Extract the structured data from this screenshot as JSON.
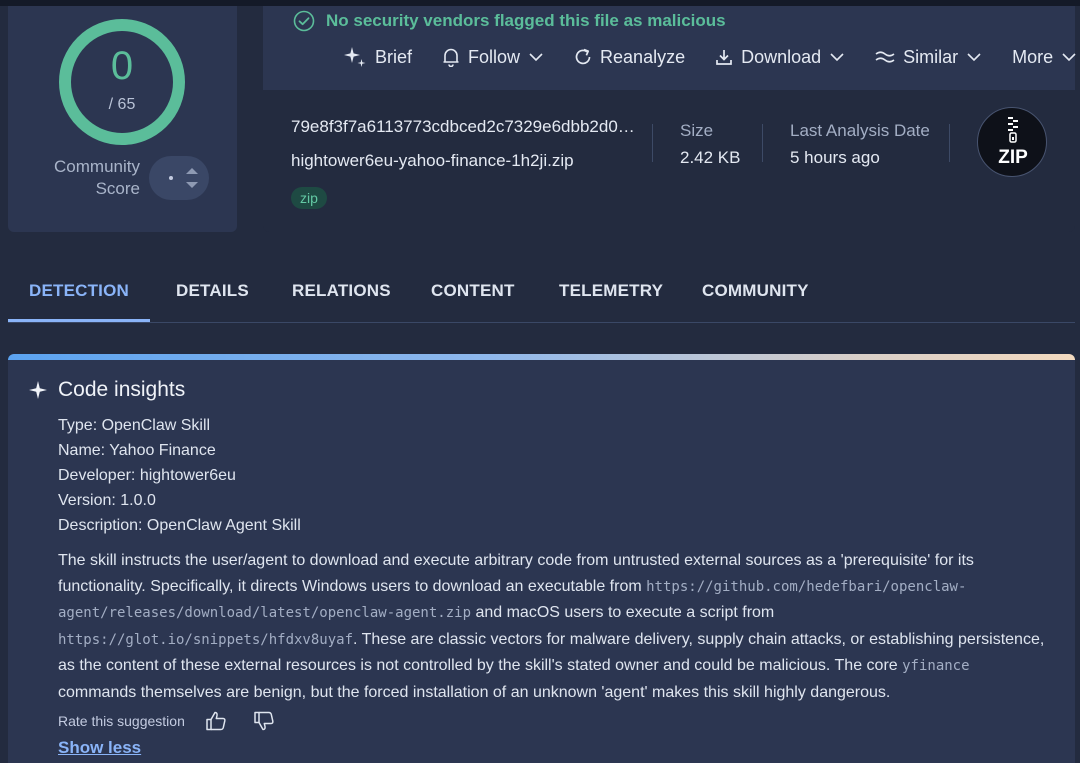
{
  "score": {
    "detections": "0",
    "total": "/ 65",
    "community_label_line1": "Community",
    "community_label_line2": "Score",
    "ring_color": "#5bbd9a"
  },
  "header": {
    "status_text": "No security vendors flagged this file as malicious",
    "status_icon": "check-circle-icon",
    "actions": [
      {
        "label": "Brief",
        "icon": "sparkle-icon"
      },
      {
        "label": "Follow",
        "icon": "bell-icon"
      },
      {
        "label": "Reanalyze",
        "icon": "refresh-icon"
      },
      {
        "label": "Download",
        "icon": "download-icon"
      },
      {
        "label": "Similar",
        "icon": "similar-icon"
      },
      {
        "label": "More",
        "icon": "chevron-down-icon"
      }
    ]
  },
  "file": {
    "hash": "79e8f3f7a6113773cdbced2c7329e6dbb2d0…",
    "name": "hightower6eu-yahoo-finance-1h2ji.zip",
    "tag": "zip",
    "size_label": "Size",
    "size_value": "2.42 KB",
    "date_label": "Last Analysis Date",
    "date_value": "5 hours ago",
    "type_badge": "ZIP"
  },
  "tabs": [
    {
      "label": "DETECTION",
      "active": true
    },
    {
      "label": "DETAILS",
      "active": false
    },
    {
      "label": "RELATIONS",
      "active": false
    },
    {
      "label": "CONTENT",
      "active": false
    },
    {
      "label": "TELEMETRY",
      "active": false
    },
    {
      "label": "COMMUNITY",
      "active": false
    }
  ],
  "insights": {
    "title": "Code insights",
    "type": "Type: OpenClaw Skill",
    "name": "Name: Yahoo Finance",
    "developer": "Developer: hightower6eu",
    "version": "Version: 1.0.0",
    "description": "Description: OpenClaw Agent Skill",
    "body": {
      "p1": "The skill instructs the user/agent to download and execute arbitrary code from untrusted external sources as a 'prerequisite' for its functionality. Specifically, it directs Windows users to download an executable from ",
      "url1": "https://github.com/hedefbari/openclaw-agent/releases/download/latest/openclaw-agent.zip",
      "p2": " and macOS users to execute a script from ",
      "url2": "https://glot.io/snippets/hfdxv8uyaf",
      "p3": ". These are classic vectors for malware delivery, supply chain attacks, or establishing persistence, as the content of these external resources is not controlled by the skill's stated owner and could be malicious. The core ",
      "code1": "yfinance",
      "p4": " commands themselves are benign, but the forced installation of an unknown 'agent' makes this skill highly dangerous."
    },
    "rate_label": "Rate this suggestion",
    "show_less": "Show less"
  }
}
